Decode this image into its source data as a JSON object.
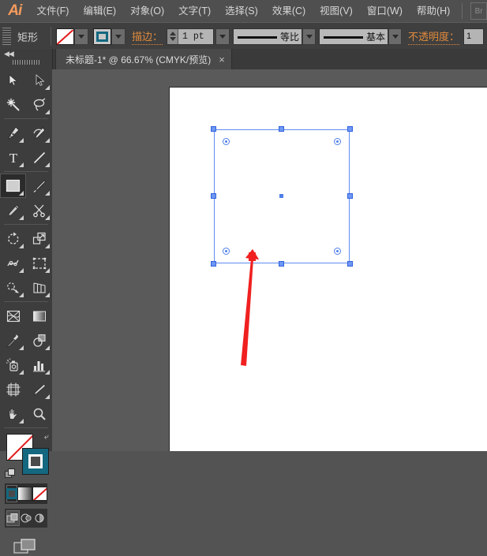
{
  "app": {
    "name": "Adobe Illustrator",
    "logo_text": "Ai",
    "bridge_button": "Br"
  },
  "menubar": {
    "items": [
      {
        "label": "文件(F)",
        "name": "menu-file"
      },
      {
        "label": "编辑(E)",
        "name": "menu-edit"
      },
      {
        "label": "对象(O)",
        "name": "menu-object"
      },
      {
        "label": "文字(T)",
        "name": "menu-type"
      },
      {
        "label": "选择(S)",
        "name": "menu-select"
      },
      {
        "label": "效果(C)",
        "name": "menu-effect"
      },
      {
        "label": "视图(V)",
        "name": "menu-view"
      },
      {
        "label": "窗口(W)",
        "name": "menu-window"
      },
      {
        "label": "帮助(H)",
        "name": "menu-help"
      }
    ]
  },
  "controlbar": {
    "object_type": "矩形",
    "fill_label": "填色",
    "fill_value": "无",
    "stroke_swatch_label": "描边颜色",
    "stroke_label": "描边：",
    "stroke_weight": "1 pt",
    "profile_dropdown": "等比",
    "brush_dropdown": "基本",
    "opacity_label": "不透明度：",
    "opacity_value": "1"
  },
  "tabbar": {
    "document_tab": "未标题-1* @ 66.67% (CMYK/预览)",
    "close_glyph": "×"
  },
  "toolpanel": {
    "collapse_glyph": "◀◀",
    "tools": [
      {
        "name": "selection-tool",
        "label": "选择工具"
      },
      {
        "name": "direct-selection-tool",
        "label": "直接选择工具"
      },
      {
        "name": "magic-wand-tool",
        "label": "魔棒工具"
      },
      {
        "name": "lasso-tool",
        "label": "套索工具"
      },
      {
        "name": "pen-tool",
        "label": "钢笔工具"
      },
      {
        "name": "add-anchor-point-tool",
        "label": "添加锚点工具"
      },
      {
        "name": "type-tool",
        "label": "文字工具"
      },
      {
        "name": "line-segment-tool",
        "label": "直线段工具"
      },
      {
        "name": "rectangle-tool",
        "label": "矩形工具"
      },
      {
        "name": "paintbrush-tool",
        "label": "画笔工具"
      },
      {
        "name": "pencil-tool",
        "label": "铅笔工具"
      },
      {
        "name": "scissors-tool",
        "label": "剪刀工具"
      },
      {
        "name": "rotate-tool",
        "label": "旋转工具"
      },
      {
        "name": "scale-tool",
        "label": "比例缩放工具"
      },
      {
        "name": "width-tool",
        "label": "宽度工具"
      },
      {
        "name": "free-transform-tool",
        "label": "自由变换工具"
      },
      {
        "name": "shape-builder-tool",
        "label": "形状生成器工具"
      },
      {
        "name": "perspective-grid-tool",
        "label": "透视网格工具"
      },
      {
        "name": "mesh-tool",
        "label": "网格工具"
      },
      {
        "name": "gradient-tool",
        "label": "渐变工具"
      },
      {
        "name": "eyedropper-tool",
        "label": "吸管工具"
      },
      {
        "name": "blend-tool",
        "label": "混合工具"
      },
      {
        "name": "symbol-sprayer-tool",
        "label": "符号喷枪工具"
      },
      {
        "name": "column-graph-tool",
        "label": "柱形图工具"
      },
      {
        "name": "artboard-tool",
        "label": "画板工具"
      },
      {
        "name": "slice-tool",
        "label": "切片工具"
      },
      {
        "name": "hand-tool",
        "label": "抓手工具"
      },
      {
        "name": "zoom-tool",
        "label": "缩放工具"
      }
    ],
    "active_tool": "rectangle-tool",
    "fill_color": "#ffffff",
    "fill_state": "无",
    "stroke_color": "#14687f",
    "swap_glyph": "⤶",
    "color_modes": [
      "颜色",
      "渐变",
      "无"
    ],
    "color_mode_selected": "颜色",
    "draw_modes": [
      "正常绘图",
      "背面绘图",
      "内部绘图"
    ],
    "draw_mode_selected": "正常绘图",
    "screen_mode": "更改屏幕模式"
  },
  "canvas": {
    "background_color": "#5a5a5a",
    "artboard_color": "#ffffff",
    "zoom_level": "66.67%",
    "color_mode": "CMYK",
    "view_mode": "预览",
    "selection": {
      "label": "选中的矩形",
      "stroke_color": "#5f8bf0",
      "handle_count": 8,
      "live_corner_count": 4,
      "has_center_point": true
    },
    "annotation": {
      "name": "red-arrow-annotation",
      "color": "#f02020",
      "points_at": "矩形下边缘"
    }
  }
}
